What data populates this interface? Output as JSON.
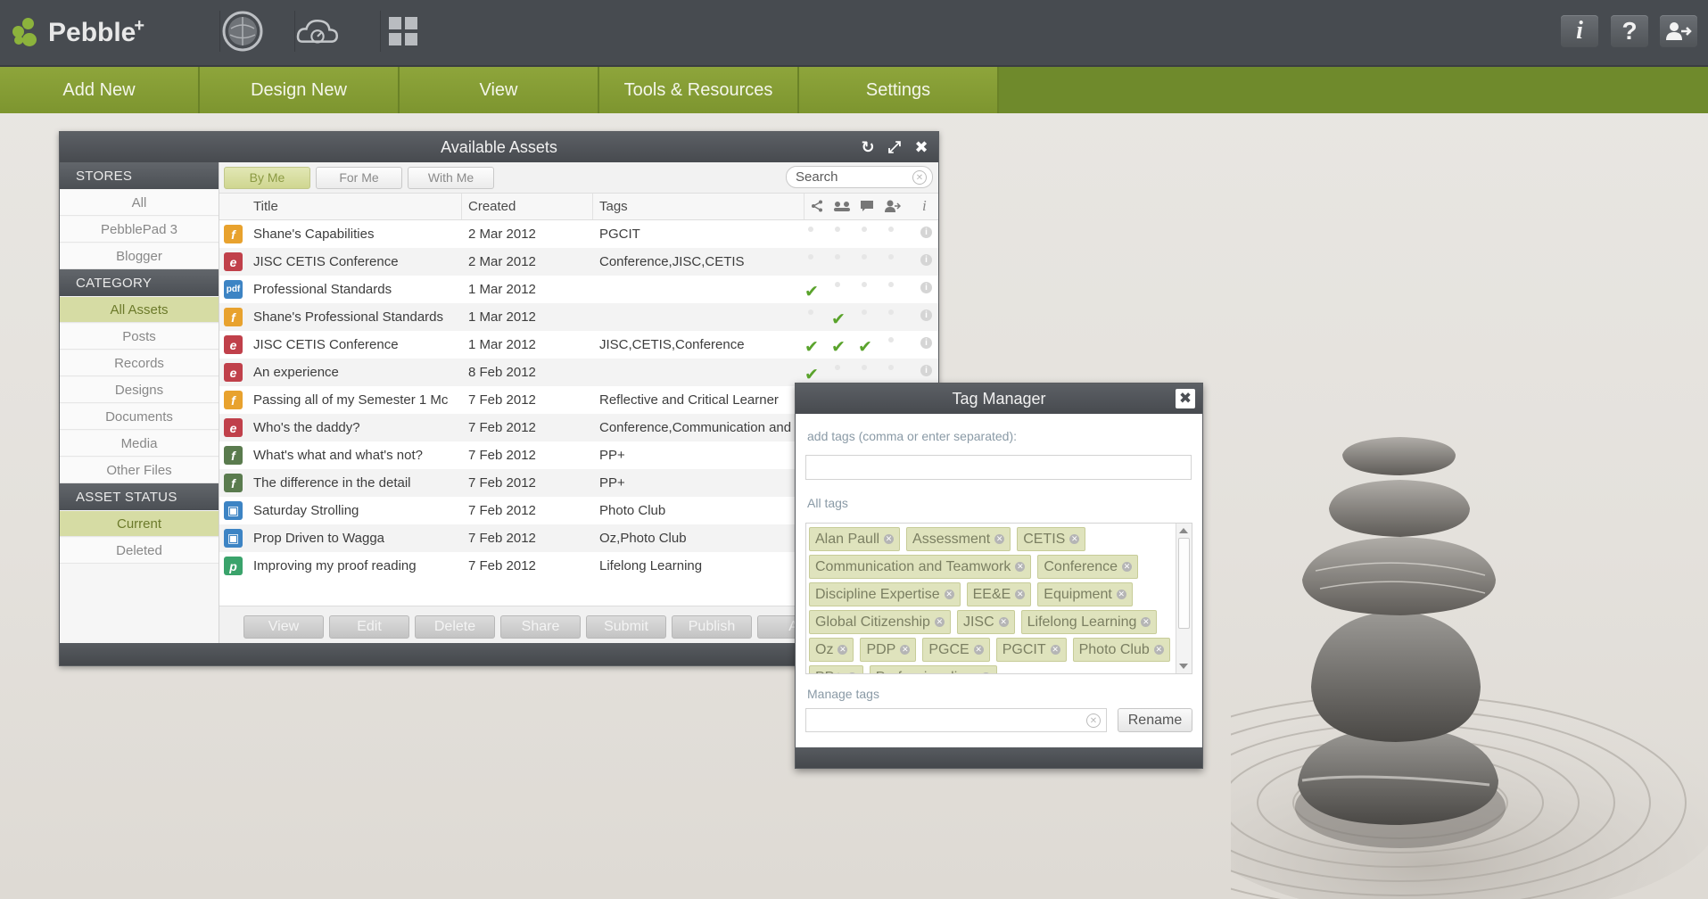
{
  "app": {
    "logo_text": "Pebble",
    "logo_sup": "+"
  },
  "top_icons": [
    "globe-icon",
    "cloud-dashboard-icon",
    "grid-apps-icon"
  ],
  "top_right_buttons": [
    {
      "icon": "info-icon",
      "glyph": "i"
    },
    {
      "icon": "help-icon",
      "glyph": "?"
    },
    {
      "icon": "user-account-icon",
      "glyph": ""
    }
  ],
  "menu": [
    "Add New",
    "Design New",
    "View",
    "Tools & Resources",
    "Settings"
  ],
  "assets_window": {
    "title": "Available Assets",
    "sidebar": {
      "stores_heading": "STORES",
      "stores": [
        "All",
        "PebblePad 3",
        "Blogger"
      ],
      "category_heading": "CATEGORY",
      "categories": [
        "All Assets",
        "Posts",
        "Records",
        "Designs",
        "Documents",
        "Media",
        "Other Files"
      ],
      "category_active": "All Assets",
      "status_heading": "ASSET STATUS",
      "statuses": [
        "Current",
        "Deleted"
      ],
      "status_active": "Current"
    },
    "filters": [
      "By Me",
      "For Me",
      "With Me"
    ],
    "filter_active": "By Me",
    "search_placeholder": "Search",
    "columns": {
      "title": "Title",
      "created": "Created",
      "tags": "Tags"
    },
    "rows": [
      {
        "icon": "f",
        "color": "#e8a22e",
        "title": "Shane's Capabilities",
        "created": "2 Mar 2012",
        "tags": "PGCIT",
        "checks": [
          0,
          0,
          0,
          0
        ]
      },
      {
        "icon": "e",
        "color": "#c0404a",
        "title": "JISC CETIS Conference",
        "created": "2 Mar 2012",
        "tags": "Conference,JISC,CETIS",
        "checks": [
          0,
          0,
          0,
          0
        ]
      },
      {
        "icon": "pdf",
        "color": "#3d84c4",
        "title": "Professional Standards",
        "created": "1 Mar 2012",
        "tags": "",
        "checks": [
          1,
          0,
          0,
          0
        ]
      },
      {
        "icon": "f",
        "color": "#e8a22e",
        "title": "Shane's Professional Standards",
        "created": "1 Mar 2012",
        "tags": "",
        "checks": [
          0,
          1,
          0,
          0
        ]
      },
      {
        "icon": "e",
        "color": "#c0404a",
        "title": "JISC CETIS Conference",
        "created": "1 Mar 2012",
        "tags": "JISC,CETIS,Conference",
        "checks": [
          1,
          1,
          1,
          0
        ]
      },
      {
        "icon": "e",
        "color": "#c0404a",
        "title": "An experience",
        "created": "8 Feb 2012",
        "tags": "",
        "checks": [
          1,
          0,
          0,
          0
        ]
      },
      {
        "icon": "f",
        "color": "#e8a22e",
        "title": "Passing all of my Semester 1 Mc",
        "created": "7 Feb 2012",
        "tags": "Reflective and Critical Learner",
        "checks": [
          0,
          0,
          0,
          0
        ]
      },
      {
        "icon": "e",
        "color": "#c0404a",
        "title": "Who's the daddy?",
        "created": "7 Feb 2012",
        "tags": "Conference,Communication and",
        "checks": [
          0,
          0,
          0,
          0
        ]
      },
      {
        "icon": "f",
        "color": "#5a7b4e",
        "title": "What's what and what's not?",
        "created": "7 Feb 2012",
        "tags": "PP+",
        "checks": [
          0,
          0,
          0,
          0
        ]
      },
      {
        "icon": "f",
        "color": "#5a7b4e",
        "title": "The difference in the detail",
        "created": "7 Feb 2012",
        "tags": "PP+",
        "checks": [
          0,
          0,
          0,
          0
        ]
      },
      {
        "icon": "img",
        "color": "#3d84c4",
        "title": "Saturday Strolling",
        "created": "7 Feb 2012",
        "tags": "Photo Club",
        "checks": [
          0,
          0,
          0,
          0
        ]
      },
      {
        "icon": "img",
        "color": "#3d84c4",
        "title": "Prop Driven to Wagga",
        "created": "7 Feb 2012",
        "tags": "Oz,Photo Club",
        "checks": [
          0,
          0,
          0,
          0
        ]
      },
      {
        "icon": "p",
        "color": "#3aa36b",
        "title": "Improving my proof reading",
        "created": "7 Feb 2012",
        "tags": "Lifelong Learning",
        "checks": [
          0,
          0,
          0,
          0
        ]
      }
    ],
    "actions": [
      "View",
      "Edit",
      "Delete",
      "Share",
      "Submit",
      "Publish",
      "Ad"
    ]
  },
  "tag_manager": {
    "title": "Tag Manager",
    "add_label": "add tags (comma or enter separated):",
    "all_tags_label": "All tags",
    "tags": [
      [
        "Alan Paull",
        "Assessment",
        "CETIS"
      ],
      [
        "Communication and Teamwork",
        "Conference"
      ],
      [
        "Discipline Expertise",
        "EE&E",
        "Equipment"
      ],
      [
        "Global Citizenship",
        "JISC",
        "Lifelong Learning"
      ],
      [
        "Oz",
        "PDP",
        "PGCE",
        "PGCIT",
        "Photo Club"
      ],
      [
        "PP+",
        "Professionalism"
      ]
    ],
    "manage_label": "Manage tags",
    "rename_label": "Rename"
  }
}
